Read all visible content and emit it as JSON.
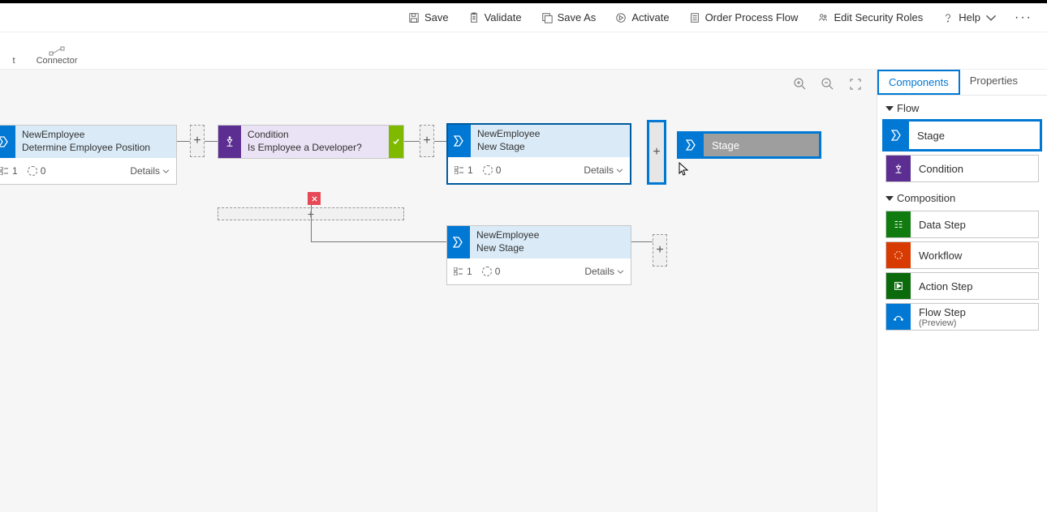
{
  "commands": {
    "save": "Save",
    "validate": "Validate",
    "save_as": "Save As",
    "activate": "Activate",
    "order": "Order Process Flow",
    "security": "Edit Security Roles",
    "help": "Help"
  },
  "subbar": {
    "cut_label": "t",
    "connector": "Connector"
  },
  "canvas": {
    "stage1": {
      "entity": "NewEmployee",
      "title": "Determine Employee Position",
      "steps": "1",
      "terms": "0",
      "details": "Details"
    },
    "cond": {
      "label": "Condition",
      "question": "Is Employee a Developer?"
    },
    "stage2": {
      "entity": "NewEmployee",
      "title": "New Stage",
      "steps": "1",
      "terms": "0",
      "details": "Details"
    },
    "stage3": {
      "entity": "NewEmployee",
      "title": "New Stage",
      "steps": "1",
      "terms": "0",
      "details": "Details"
    },
    "drag_label": "Stage"
  },
  "panel": {
    "tab_components": "Components",
    "tab_properties": "Properties",
    "sect_flow": "Flow",
    "sect_composition": "Composition",
    "tiles": {
      "stage": "Stage",
      "condition": "Condition",
      "data_step": "Data Step",
      "workflow": "Workflow",
      "action_step": "Action Step",
      "flow_step": "Flow Step",
      "flow_step_sub": "(Preview)"
    }
  }
}
